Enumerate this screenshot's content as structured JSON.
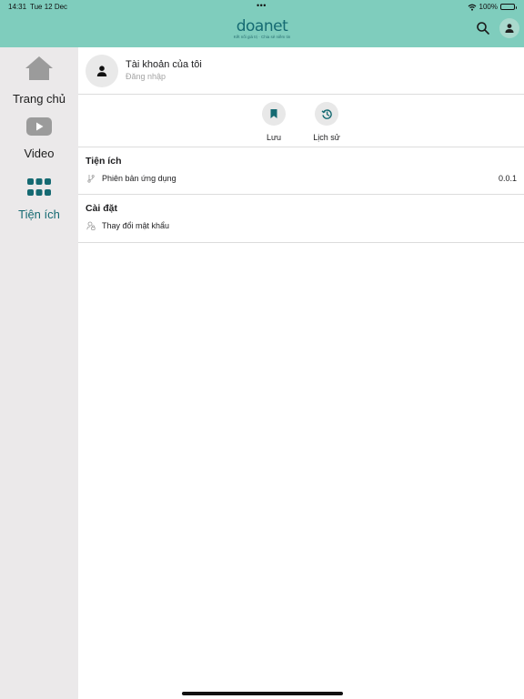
{
  "status_bar": {
    "time": "14:31",
    "date": "Tue 12 Dec",
    "dots": "•••",
    "battery": "100%"
  },
  "header": {
    "logo": "doanet",
    "tagline": "Kết nối giá trị · Chia sẻ niềm tin",
    "background_color": "#7fcdbd",
    "accent_color": "#156a72"
  },
  "sidebar": {
    "items": [
      {
        "label": "Trang chủ",
        "icon": "home-icon",
        "active": false
      },
      {
        "label": "Video",
        "icon": "video-icon",
        "active": false
      },
      {
        "label": "Tiện ích",
        "icon": "grid-icon",
        "active": true
      }
    ]
  },
  "account": {
    "title": "Tài khoản của tôi",
    "subtitle": "Đăng nhập",
    "icon": "user-icon"
  },
  "quick_actions": [
    {
      "label": "Lưu",
      "icon": "bookmark-icon"
    },
    {
      "label": "Lịch sử",
      "icon": "history-icon"
    }
  ],
  "sections": {
    "utilities": {
      "title": "Tiện ích",
      "rows": [
        {
          "label": "Phiên bản ứng dụng",
          "value": "0.0.1",
          "icon": "branch-icon"
        }
      ]
    },
    "settings": {
      "title": "Cài đặt",
      "rows": [
        {
          "label": "Thay đổi mật khẩu",
          "icon": "user-lock-icon"
        }
      ]
    }
  }
}
